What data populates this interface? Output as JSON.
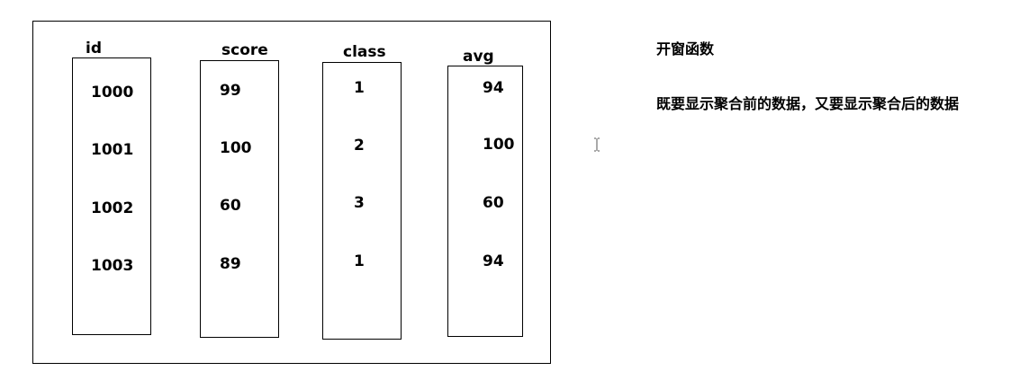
{
  "table": {
    "columns": [
      {
        "header": "id",
        "values": [
          "1000",
          "1001",
          "1002",
          "1003"
        ]
      },
      {
        "header": "score",
        "values": [
          "99",
          "100",
          "60",
          "89"
        ]
      },
      {
        "header": "class",
        "values": [
          "1",
          "2",
          "3",
          "1"
        ]
      },
      {
        "header": "avg",
        "values": [
          "94",
          "100",
          "60",
          "94"
        ]
      }
    ]
  },
  "notes": {
    "title": "开窗函数",
    "body": "既要显示聚合前的数据，又要显示聚合后的数据"
  },
  "cursor": {
    "icon": "text-cursor-icon"
  }
}
